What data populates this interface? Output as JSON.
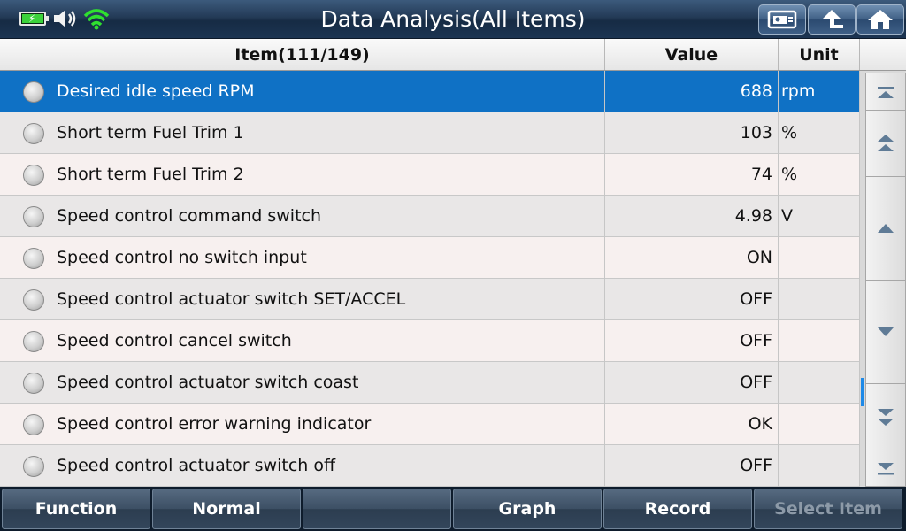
{
  "title": "Data Analysis(All Items)",
  "status": {
    "battery_icon": "battery-charging-icon",
    "volume_icon": "speaker-icon",
    "wifi_icon": "wifi-icon"
  },
  "top_buttons": [
    {
      "name": "screenshot-button",
      "icon": "camera-card-icon"
    },
    {
      "name": "back-button",
      "icon": "return-arrow-icon"
    },
    {
      "name": "home-button",
      "icon": "home-icon"
    }
  ],
  "table": {
    "headers": {
      "item": "Item(111/149)",
      "value": "Value",
      "unit": "Unit"
    },
    "rows": [
      {
        "item": "Desired idle speed RPM",
        "value": "688",
        "unit": "rpm",
        "selected": true
      },
      {
        "item": "Short term Fuel Trim 1",
        "value": "103",
        "unit": "%"
      },
      {
        "item": "Short term Fuel Trim 2",
        "value": "74",
        "unit": "%"
      },
      {
        "item": "Speed control command switch",
        "value": "4.98",
        "unit": "V"
      },
      {
        "item": "Speed control no switch input",
        "value": "ON",
        "unit": ""
      },
      {
        "item": "Speed control actuator switch SET/ACCEL",
        "value": "OFF",
        "unit": ""
      },
      {
        "item": "Speed control cancel switch",
        "value": "OFF",
        "unit": ""
      },
      {
        "item": "Speed control actuator switch coast",
        "value": "OFF",
        "unit": ""
      },
      {
        "item": "Speed control error warning indicator",
        "value": "OK",
        "unit": ""
      },
      {
        "item": "Speed control actuator switch off",
        "value": "OFF",
        "unit": ""
      }
    ]
  },
  "bottom_buttons": [
    {
      "label": "Function",
      "enabled": true
    },
    {
      "label": "Normal",
      "enabled": true
    },
    {
      "label": "",
      "enabled": true
    },
    {
      "label": "Graph",
      "enabled": true
    },
    {
      "label": "Record",
      "enabled": true
    },
    {
      "label": "Select Item",
      "enabled": false
    }
  ],
  "colors": {
    "selected_row": "#0f71c5",
    "title_bar": "#233a56",
    "scroll_indicator": "#1e8ae8"
  }
}
